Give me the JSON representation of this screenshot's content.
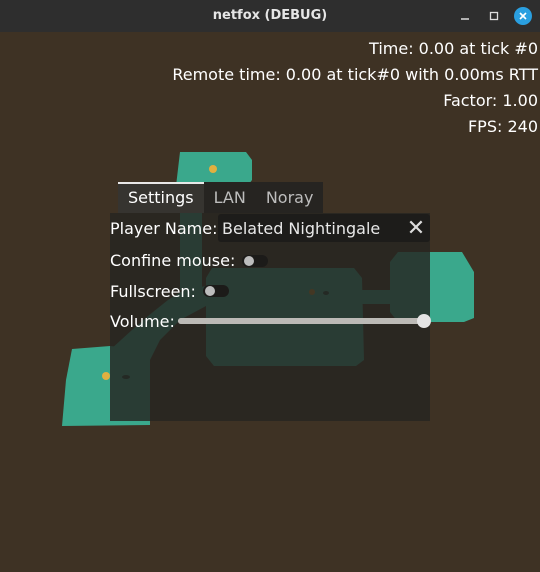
{
  "window": {
    "title": "netfox (DEBUG)",
    "minimize_icon": "minimize-icon",
    "maximize_icon": "maximize-icon",
    "close_icon": "close-icon"
  },
  "stats": {
    "time": "Time: 0.00 at tick #0",
    "remote_time": "Remote time: 0.00 at tick#0 with 0.00ms RTT",
    "factor": "Factor: 1.00",
    "fps": "FPS: 240"
  },
  "menu": {
    "tabs": [
      {
        "label": "Settings",
        "active": true
      },
      {
        "label": "LAN",
        "active": false
      },
      {
        "label": "Noray",
        "active": false
      }
    ],
    "player_name_label": "Player Name:",
    "player_name_value": "Belated Nightingale",
    "confine_mouse_label": "Confine mouse:",
    "confine_mouse_on": false,
    "fullscreen_label": "Fullscreen:",
    "fullscreen_on": false,
    "volume_label": "Volume:",
    "volume_level": 1.0
  },
  "colors": {
    "background": "#3e3224",
    "floor": "#3aa88c",
    "panel": "#262421",
    "close_button": "#2a9fe0"
  }
}
